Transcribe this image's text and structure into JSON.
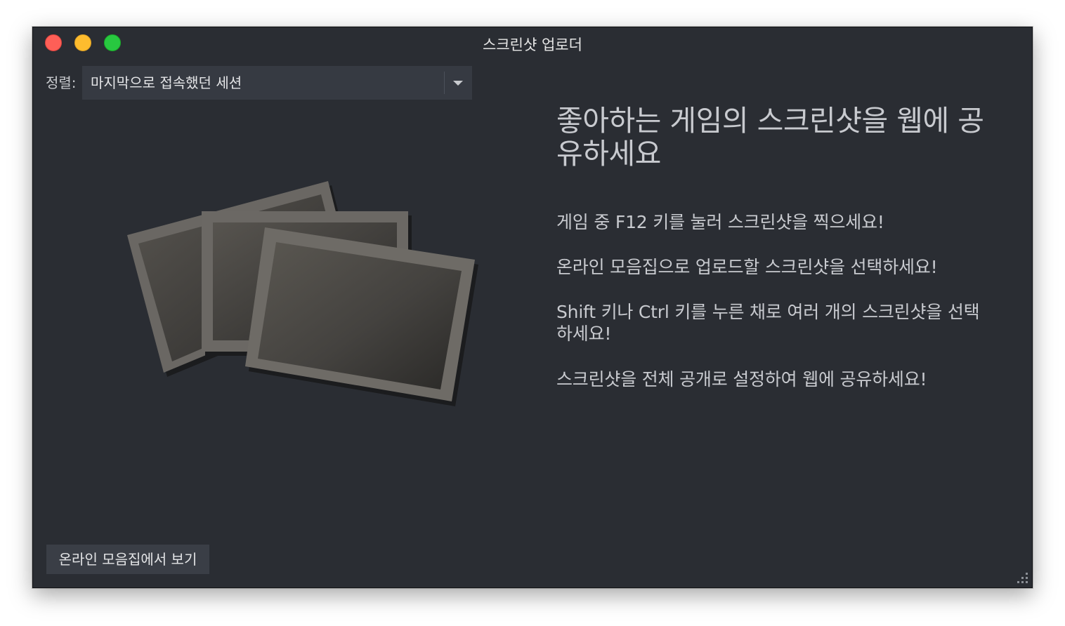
{
  "window": {
    "title": "스크린샷 업로더"
  },
  "sort": {
    "label": "정렬:",
    "selected": "마지막으로 접속했던 세션"
  },
  "info": {
    "headline": "좋아하는 게임의 스크린샷을 웹에 공유하세요",
    "tips": [
      "게임 중 F12 키를 눌러 스크린샷을 찍으세요!",
      "온라인 모음집으로 업로드할 스크린샷을 선택하세요!",
      "Shift 키나 Ctrl 키를 누른 채로 여러 개의 스크린샷을 선택하세요!",
      "스크린샷을 전체 공개로 설정하여 웹에 공유하세요!"
    ]
  },
  "footer": {
    "view_online_label": "온라인 모음집에서 보기"
  },
  "icons": {
    "close": "close-icon",
    "minimize": "minimize-icon",
    "maximize": "maximize-icon",
    "dropdown": "chevron-down-icon",
    "illustration": "screenshot-stack-icon",
    "resize": "resize-grip-icon"
  },
  "colors": {
    "background": "#2a2d33",
    "close": "#fe5f57",
    "minimize": "#febc2e",
    "maximize": "#28c840",
    "text": "#c8cacf"
  }
}
